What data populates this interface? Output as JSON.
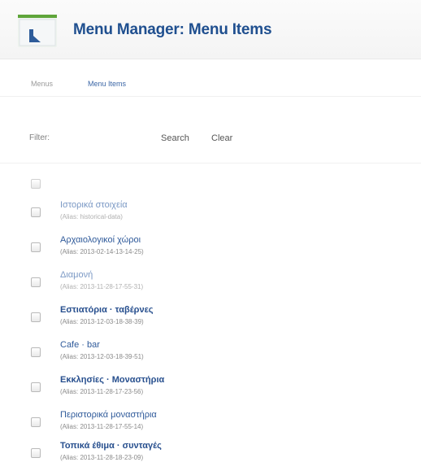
{
  "header": {
    "title": "Menu Manager: Menu Items",
    "icon": "menu-manager-icon"
  },
  "subtabs": {
    "menus_label": "Menus",
    "menu_items_label": "Menu Items"
  },
  "filter": {
    "label": "Filter:",
    "value": "",
    "search_label": "Search",
    "clear_label": "Clear"
  },
  "items": [
    {
      "title": "Ιστορικά στοιχεία",
      "alias": "(Alias: historical-data)"
    },
    {
      "title": "Αρχαιολογικοί χώροι",
      "alias": "(Alias: 2013-02-14-13-14-25)"
    },
    {
      "title": "Διαμονή",
      "alias": "(Alias: 2013-11-28-17-55-31)"
    },
    {
      "title": "Εστιατόρια · ταβέρνες",
      "alias": "(Alias: 2013-12-03-18-38-39)"
    },
    {
      "title": "Cafe · bar",
      "alias": "(Alias: 2013-12-03-18-39-51)"
    },
    {
      "title": "Εκκλησίες · Μοναστήρια",
      "alias": "(Alias: 2013-11-28-17-23-56)"
    },
    {
      "title": "Περιστορικά μοναστήρια",
      "alias": "(Alias: 2013-11-28-17-55-14)"
    },
    {
      "title": "Τοπικά έθιμα · συνταγές",
      "alias": "(Alias: 2013-11-28-18-23-09)"
    }
  ]
}
